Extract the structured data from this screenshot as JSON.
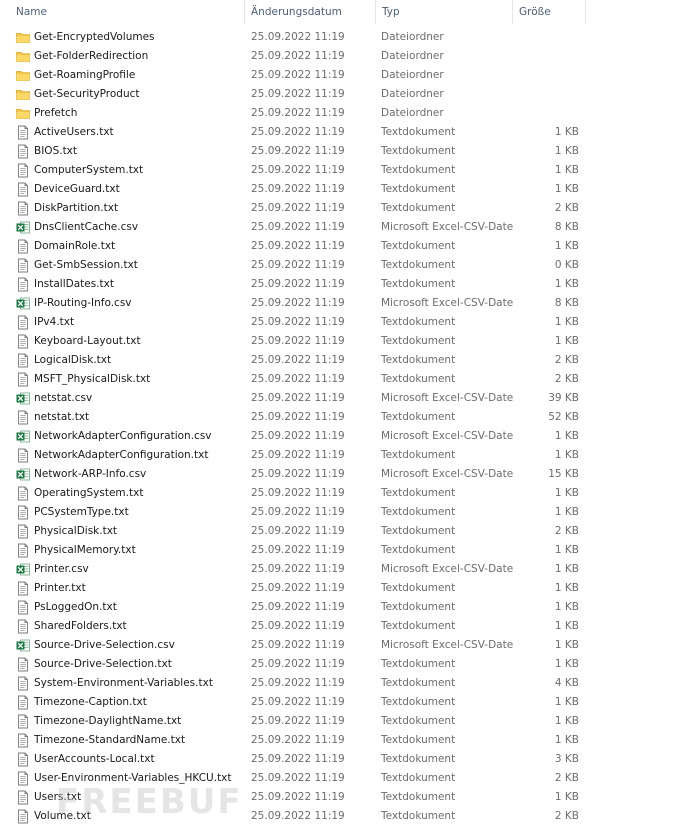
{
  "header": {
    "name": "Name",
    "date": "Änderungsdatum",
    "type": "Typ",
    "size": "Größe",
    "sort_indicator": "^"
  },
  "colors": {
    "folder": "#f7c948",
    "text_file": "#ffffff",
    "excel": "#1d7a44",
    "header_text": "#4c607a"
  },
  "files": [
    {
      "name": "Get-EncryptedVolumes",
      "date": "25.09.2022 11:19",
      "type": "Dateiordner",
      "size": "",
      "icon": "folder-icon"
    },
    {
      "name": "Get-FolderRedirection",
      "date": "25.09.2022 11:19",
      "type": "Dateiordner",
      "size": "",
      "icon": "folder-icon"
    },
    {
      "name": "Get-RoamingProfile",
      "date": "25.09.2022 11:19",
      "type": "Dateiordner",
      "size": "",
      "icon": "folder-icon"
    },
    {
      "name": "Get-SecurityProduct",
      "date": "25.09.2022 11:19",
      "type": "Dateiordner",
      "size": "",
      "icon": "folder-icon"
    },
    {
      "name": "Prefetch",
      "date": "25.09.2022 11:19",
      "type": "Dateiordner",
      "size": "",
      "icon": "folder-icon"
    },
    {
      "name": "ActiveUsers.txt",
      "date": "25.09.2022 11:19",
      "type": "Textdokument",
      "size": "1 KB",
      "icon": "text-file-icon"
    },
    {
      "name": "BIOS.txt",
      "date": "25.09.2022 11:19",
      "type": "Textdokument",
      "size": "1 KB",
      "icon": "text-file-icon"
    },
    {
      "name": "ComputerSystem.txt",
      "date": "25.09.2022 11:19",
      "type": "Textdokument",
      "size": "1 KB",
      "icon": "text-file-icon"
    },
    {
      "name": "DeviceGuard.txt",
      "date": "25.09.2022 11:19",
      "type": "Textdokument",
      "size": "1 KB",
      "icon": "text-file-icon"
    },
    {
      "name": "DiskPartition.txt",
      "date": "25.09.2022 11:19",
      "type": "Textdokument",
      "size": "2 KB",
      "icon": "text-file-icon"
    },
    {
      "name": "DnsClientCache.csv",
      "date": "25.09.2022 11:19",
      "type": "Microsoft Excel-CSV-Datei",
      "size": "8 KB",
      "icon": "excel-csv-icon"
    },
    {
      "name": "DomainRole.txt",
      "date": "25.09.2022 11:19",
      "type": "Textdokument",
      "size": "1 KB",
      "icon": "text-file-icon"
    },
    {
      "name": "Get-SmbSession.txt",
      "date": "25.09.2022 11:19",
      "type": "Textdokument",
      "size": "0 KB",
      "icon": "text-file-icon"
    },
    {
      "name": "InstallDates.txt",
      "date": "25.09.2022 11:19",
      "type": "Textdokument",
      "size": "1 KB",
      "icon": "text-file-icon"
    },
    {
      "name": "IP-Routing-Info.csv",
      "date": "25.09.2022 11:19",
      "type": "Microsoft Excel-CSV-Datei",
      "size": "8 KB",
      "icon": "excel-csv-icon"
    },
    {
      "name": "IPv4.txt",
      "date": "25.09.2022 11:19",
      "type": "Textdokument",
      "size": "1 KB",
      "icon": "text-file-icon"
    },
    {
      "name": "Keyboard-Layout.txt",
      "date": "25.09.2022 11:19",
      "type": "Textdokument",
      "size": "1 KB",
      "icon": "text-file-icon"
    },
    {
      "name": "LogicalDisk.txt",
      "date": "25.09.2022 11:19",
      "type": "Textdokument",
      "size": "2 KB",
      "icon": "text-file-icon"
    },
    {
      "name": "MSFT_PhysicalDisk.txt",
      "date": "25.09.2022 11:19",
      "type": "Textdokument",
      "size": "2 KB",
      "icon": "text-file-icon"
    },
    {
      "name": "netstat.csv",
      "date": "25.09.2022 11:19",
      "type": "Microsoft Excel-CSV-Datei",
      "size": "39 KB",
      "icon": "excel-csv-icon"
    },
    {
      "name": "netstat.txt",
      "date": "25.09.2022 11:19",
      "type": "Textdokument",
      "size": "52 KB",
      "icon": "text-file-icon"
    },
    {
      "name": "NetworkAdapterConfiguration.csv",
      "date": "25.09.2022 11:19",
      "type": "Microsoft Excel-CSV-Datei",
      "size": "1 KB",
      "icon": "excel-csv-icon"
    },
    {
      "name": "NetworkAdapterConfiguration.txt",
      "date": "25.09.2022 11:19",
      "type": "Textdokument",
      "size": "1 KB",
      "icon": "text-file-icon"
    },
    {
      "name": "Network-ARP-Info.csv",
      "date": "25.09.2022 11:19",
      "type": "Microsoft Excel-CSV-Datei",
      "size": "15 KB",
      "icon": "excel-csv-icon"
    },
    {
      "name": "OperatingSystem.txt",
      "date": "25.09.2022 11:19",
      "type": "Textdokument",
      "size": "1 KB",
      "icon": "text-file-icon"
    },
    {
      "name": "PCSystemType.txt",
      "date": "25.09.2022 11:19",
      "type": "Textdokument",
      "size": "1 KB",
      "icon": "text-file-icon"
    },
    {
      "name": "PhysicalDisk.txt",
      "date": "25.09.2022 11:19",
      "type": "Textdokument",
      "size": "2 KB",
      "icon": "text-file-icon"
    },
    {
      "name": "PhysicalMemory.txt",
      "date": "25.09.2022 11:19",
      "type": "Textdokument",
      "size": "1 KB",
      "icon": "text-file-icon"
    },
    {
      "name": "Printer.csv",
      "date": "25.09.2022 11:19",
      "type": "Microsoft Excel-CSV-Datei",
      "size": "1 KB",
      "icon": "excel-csv-icon"
    },
    {
      "name": "Printer.txt",
      "date": "25.09.2022 11:19",
      "type": "Textdokument",
      "size": "1 KB",
      "icon": "text-file-icon"
    },
    {
      "name": "PsLoggedOn.txt",
      "date": "25.09.2022 11:19",
      "type": "Textdokument",
      "size": "1 KB",
      "icon": "text-file-icon"
    },
    {
      "name": "SharedFolders.txt",
      "date": "25.09.2022 11:19",
      "type": "Textdokument",
      "size": "1 KB",
      "icon": "text-file-icon"
    },
    {
      "name": "Source-Drive-Selection.csv",
      "date": "25.09.2022 11:19",
      "type": "Microsoft Excel-CSV-Datei",
      "size": "1 KB",
      "icon": "excel-csv-icon"
    },
    {
      "name": "Source-Drive-Selection.txt",
      "date": "25.09.2022 11:19",
      "type": "Textdokument",
      "size": "1 KB",
      "icon": "text-file-icon"
    },
    {
      "name": "System-Environment-Variables.txt",
      "date": "25.09.2022 11:19",
      "type": "Textdokument",
      "size": "4 KB",
      "icon": "text-file-icon"
    },
    {
      "name": "Timezone-Caption.txt",
      "date": "25.09.2022 11:19",
      "type": "Textdokument",
      "size": "1 KB",
      "icon": "text-file-icon"
    },
    {
      "name": "Timezone-DaylightName.txt",
      "date": "25.09.2022 11:19",
      "type": "Textdokument",
      "size": "1 KB",
      "icon": "text-file-icon"
    },
    {
      "name": "Timezone-StandardName.txt",
      "date": "25.09.2022 11:19",
      "type": "Textdokument",
      "size": "1 KB",
      "icon": "text-file-icon"
    },
    {
      "name": "UserAccounts-Local.txt",
      "date": "25.09.2022 11:19",
      "type": "Textdokument",
      "size": "3 KB",
      "icon": "text-file-icon"
    },
    {
      "name": "User-Environment-Variables_HKCU.txt",
      "date": "25.09.2022 11:19",
      "type": "Textdokument",
      "size": "2 KB",
      "icon": "text-file-icon"
    },
    {
      "name": "Users.txt",
      "date": "25.09.2022 11:19",
      "type": "Textdokument",
      "size": "1 KB",
      "icon": "text-file-icon"
    },
    {
      "name": "Volume.txt",
      "date": "25.09.2022 11:19",
      "type": "Textdokument",
      "size": "2 KB",
      "icon": "text-file-icon"
    }
  ],
  "watermark": "FREEBUF"
}
